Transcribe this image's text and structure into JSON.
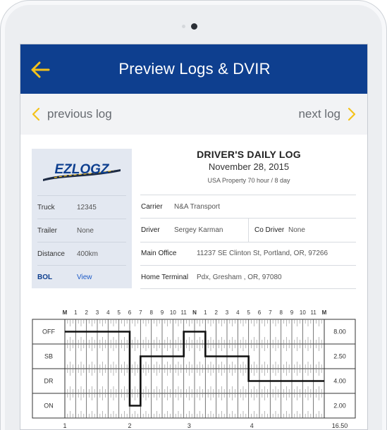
{
  "header": {
    "title": "Preview Logs & DVIR",
    "accent_color": "#f4c21a",
    "bar_color": "#0e3f8f"
  },
  "nav": {
    "previous_label": "previous log",
    "next_label": "next log"
  },
  "logo": {
    "text": "EZLOGZ"
  },
  "log": {
    "title": "DRIVER'S DAILY LOG",
    "date": "November 28, 2015",
    "cycle": "USA Property 70 hour / 8 day"
  },
  "vehicle": {
    "truck_label": "Truck",
    "truck_value": "12345",
    "trailer_label": "Trailer",
    "trailer_value": "None",
    "distance_label": "Distance",
    "distance_value": "400km",
    "bol_label": "BOL",
    "bol_value": "View"
  },
  "details": {
    "carrier_label": "Carrier",
    "carrier_value": "N&A Transport",
    "driver_label": "Driver",
    "driver_value": "Sergey Karman",
    "codriver_label": "Co Driver",
    "codriver_value": "None",
    "main_office_label": "Main Office",
    "main_office_value": "11237 SE Clinton St, Portland, OR, 97266",
    "home_terminal_label": "Home Terminal",
    "home_terminal_value": "Pdx, Gresham , OR, 97080"
  },
  "chart_data": {
    "type": "line",
    "hour_labels": [
      "M",
      "1",
      "2",
      "3",
      "4",
      "5",
      "6",
      "7",
      "8",
      "9",
      "10",
      "11",
      "N",
      "1",
      "2",
      "3",
      "4",
      "5",
      "6",
      "7",
      "8",
      "9",
      "10",
      "11",
      "M"
    ],
    "rows": [
      "OFF",
      "SB",
      "DR",
      "ON"
    ],
    "totals": [
      "8.00",
      "2.50",
      "4.00",
      "2.00"
    ],
    "bottom_labels": [
      "1",
      "2",
      "3",
      "4",
      "16.50"
    ],
    "status_changes": [
      {
        "hour": 0,
        "status": "OFF"
      },
      {
        "hour": 6,
        "status": "ON"
      },
      {
        "hour": 7,
        "status": "SB"
      },
      {
        "hour": 11,
        "status": "OFF"
      },
      {
        "hour": 13,
        "status": "SB"
      },
      {
        "hour": 17,
        "status": "DR"
      },
      {
        "hour": 24,
        "status": "DR"
      }
    ]
  }
}
